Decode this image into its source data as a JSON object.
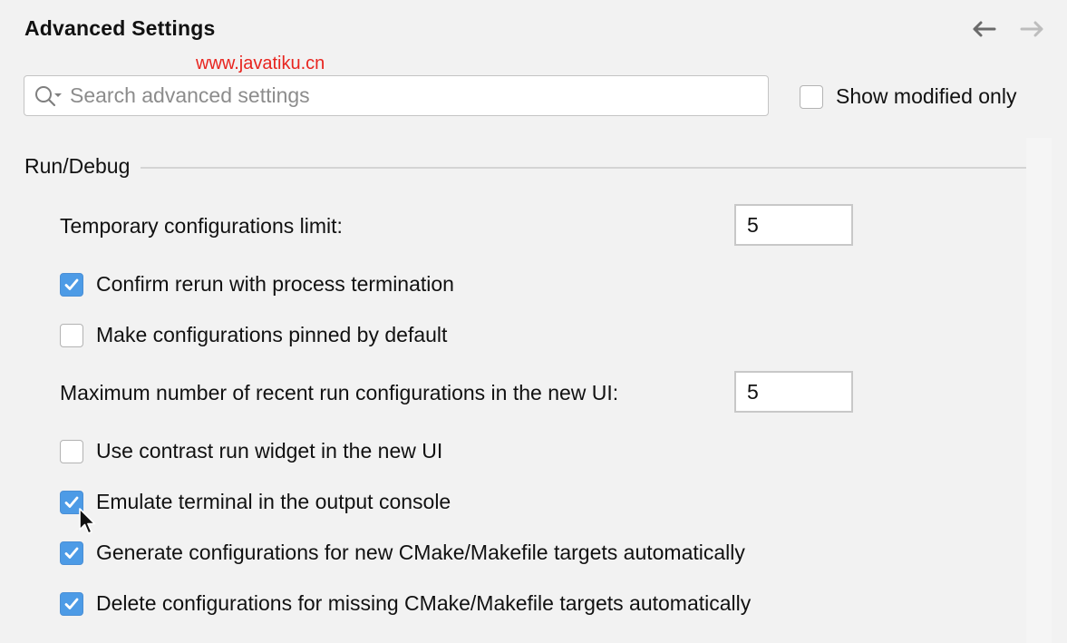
{
  "header": {
    "title": "Advanced Settings",
    "back_icon": "arrow-left-icon",
    "forward_icon": "arrow-right-icon"
  },
  "watermark": "www.javatiku.cn",
  "search": {
    "placeholder": "Search advanced settings",
    "value": "",
    "icon": "search-icon"
  },
  "show_modified": {
    "label": "Show modified only",
    "checked": false
  },
  "group": {
    "title": "Run/Debug",
    "settings": [
      {
        "type": "number",
        "label": "Temporary configurations limit:",
        "value": "5"
      },
      {
        "type": "checkbox",
        "label": "Confirm rerun with process termination",
        "checked": true
      },
      {
        "type": "checkbox",
        "label": "Make configurations pinned by default",
        "checked": false
      },
      {
        "type": "number",
        "label": "Maximum number of recent run configurations in the new UI:",
        "value": "5"
      },
      {
        "type": "checkbox",
        "label": "Use contrast run widget in the new UI",
        "checked": false
      },
      {
        "type": "checkbox",
        "label": "Emulate terminal in the output console",
        "checked": true
      },
      {
        "type": "checkbox",
        "label": "Generate configurations for new CMake/Makefile targets automatically",
        "checked": true
      },
      {
        "type": "checkbox",
        "label": "Delete configurations for missing CMake/Makefile targets automatically",
        "checked": true
      }
    ]
  },
  "colors": {
    "accent": "#4d9be6",
    "background": "#f2f2f2",
    "watermark": "#e8251f"
  }
}
